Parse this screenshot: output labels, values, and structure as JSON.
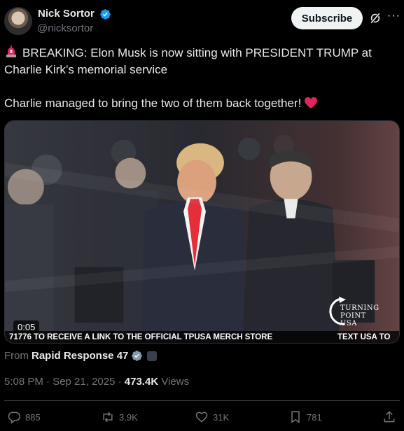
{
  "author": {
    "name": "Nick Sortor",
    "handle": "@nicksortor",
    "verified": true
  },
  "header": {
    "subscribe_label": "Subscribe",
    "grok_icon": "grok-icon",
    "more_icon": "more-icon"
  },
  "tweet": {
    "line1": "BREAKING: Elon Musk is now sitting with PRESIDENT TRUMP at Charlie Kirk’s memorial service",
    "line2": "Charlie managed to bring the two of them back together!",
    "lead_icon": "siren-icon",
    "trail_icon": "red-heart-icon"
  },
  "media": {
    "duration": "0:05",
    "ticker_main": "71776 TO RECEIVE A LINK TO THE OFFICIAL TPUSA MERCH STORE",
    "ticker_next": "TEXT USA TO",
    "logo_line1": "TURNING",
    "logo_line2": "POINT USA"
  },
  "attribution": {
    "prefix": "From",
    "source": "Rapid Response 47"
  },
  "meta": {
    "time": "5:08 PM · Sep 21, 2025 · ",
    "views_count": "473.4K",
    "views_label": " Views"
  },
  "actions": {
    "replies": "885",
    "reposts": "3.9K",
    "likes": "31K",
    "bookmarks": "781"
  },
  "colors": {
    "accent": "#1d9bf0",
    "heart": "#f91880",
    "text": "#e7e9ea",
    "muted": "#71767b"
  }
}
